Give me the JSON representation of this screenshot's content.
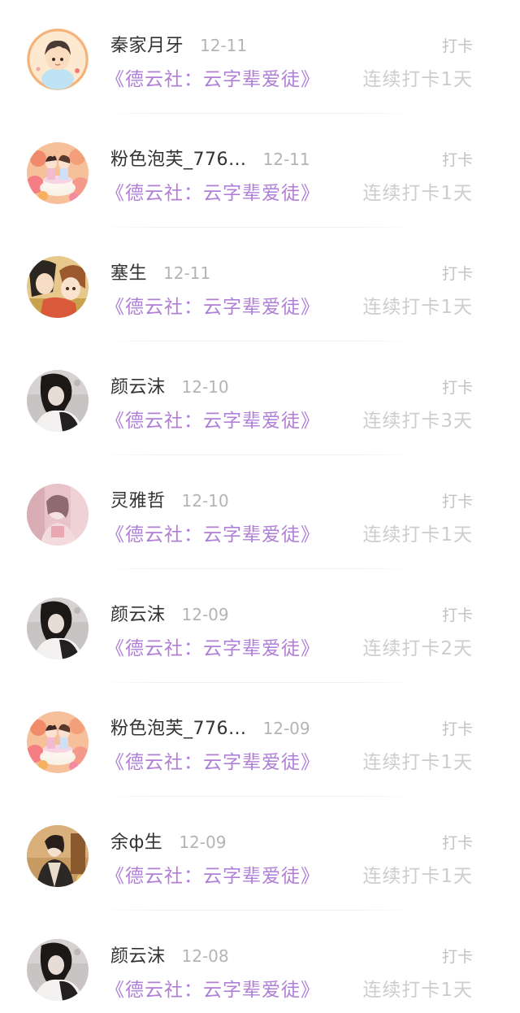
{
  "checkin_list": {
    "items": [
      {
        "name": "秦家月牙",
        "date": "12-11",
        "tag": "打卡",
        "course": "《德云社：云字辈爱徒》",
        "streak": "连续打卡1天",
        "avatar_icon": "cartoon-boy-avatar-icon"
      },
      {
        "name": "粉色泡芙_776…",
        "date": "12-11",
        "tag": "打卡",
        "course": "《德云社：云字辈爱徒》",
        "streak": "连续打卡1天",
        "avatar_icon": "flower-cake-avatar-icon"
      },
      {
        "name": "塞生",
        "date": "12-11",
        "tag": "打卡",
        "course": "《德云社：云字辈爱徒》",
        "streak": "连续打卡1天",
        "avatar_icon": "anime-pair-avatar-icon"
      },
      {
        "name": "颜云沫",
        "date": "12-10",
        "tag": "打卡",
        "course": "《德云社：云字辈爱徒》",
        "streak": "连续打卡3天",
        "avatar_icon": "dark-portrait-avatar-icon"
      },
      {
        "name": "灵雅哲",
        "date": "12-10",
        "tag": "打卡",
        "course": "《德云社：云字辈爱徒》",
        "streak": "连续打卡1天",
        "avatar_icon": "pink-portrait-avatar-icon"
      },
      {
        "name": "颜云沫",
        "date": "12-09",
        "tag": "打卡",
        "course": "《德云社：云字辈爱徒》",
        "streak": "连续打卡2天",
        "avatar_icon": "dark-portrait-avatar-icon"
      },
      {
        "name": "粉色泡芙_776…",
        "date": "12-09",
        "tag": "打卡",
        "course": "《德云社：云字辈爱徒》",
        "streak": "连续打卡1天",
        "avatar_icon": "flower-cake-avatar-icon"
      },
      {
        "name": "余ф生",
        "date": "12-09",
        "tag": "打卡",
        "course": "《德云社：云字辈爱徒》",
        "streak": "连续打卡1天",
        "avatar_icon": "costume-figure-avatar-icon"
      },
      {
        "name": "颜云沫",
        "date": "12-08",
        "tag": "打卡",
        "course": "《德云社：云字辈爱徒》",
        "streak": "连续打卡1天",
        "avatar_icon": "dark-portrait-avatar-icon"
      }
    ]
  },
  "colors": {
    "name": "#333333",
    "date": "#b4b4b4",
    "course": "#b07fd6",
    "streak": "#cdcdcd",
    "tag": "#c2c2c2"
  }
}
